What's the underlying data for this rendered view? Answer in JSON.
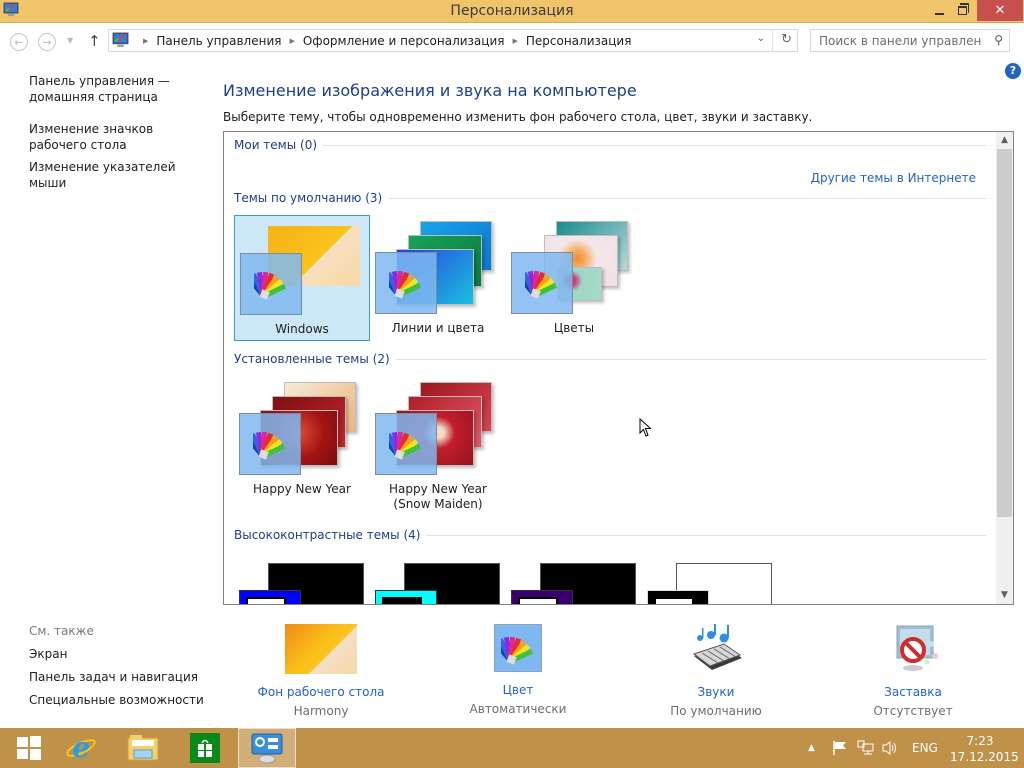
{
  "window": {
    "title": "Персонализация",
    "controls": {
      "minimize": "–",
      "maximize": "□",
      "close": "✕"
    }
  },
  "navbar": {
    "back_icon": "←",
    "forward_icon": "→",
    "recent_icon": "▼",
    "up_icon": "↑",
    "breadcrumbs": [
      "Панель управления",
      "Оформление и персонализация",
      "Персонализация"
    ],
    "breadcrumb_separator": "▶",
    "dropdown_icon": "⌄",
    "refresh_icon": "↻",
    "search": {
      "placeholder": "Поиск в панели управления",
      "value": "",
      "icon": "⚲"
    }
  },
  "help_icon": "?",
  "sidebar": {
    "links": [
      "Панель управления — домашняя страница",
      "Изменение значков рабочего стола",
      "Изменение указателей мыши"
    ],
    "see_also_title": "См. также",
    "see_also": [
      "Экран",
      "Панель задач и навигация",
      "Специальные возможности"
    ]
  },
  "main": {
    "title": "Изменение изображения и звука на компьютере",
    "description": "Выберите тему, чтобы одновременно изменить фон рабочего стола, цвет, звуки и заставку.",
    "online_link": "Другие темы в Интернете",
    "groups": [
      {
        "label": "Мои темы (0)"
      },
      {
        "label": "Темы по умолчанию (3)"
      },
      {
        "label": "Установленные темы (2)"
      },
      {
        "label": "Высококонтрастные темы (4)"
      }
    ],
    "themes": {
      "default": [
        {
          "label": "Windows",
          "selected": true
        },
        {
          "label": "Линии и цвета",
          "selected": false
        },
        {
          "label": "Цветы",
          "selected": false
        }
      ],
      "installed": [
        {
          "label": "Happy New Year"
        },
        {
          "label": "Happy New Year\n(Snow Maiden)"
        }
      ],
      "high_contrast": [
        {
          "big": "#000000",
          "small": "#0000ff",
          "inner": "#ffffff"
        },
        {
          "big": "#000000",
          "small": "#00ffff",
          "inner": "#000000"
        },
        {
          "big": "#000000",
          "small": "#37006e",
          "inner": "#ffffff"
        },
        {
          "big": "#ffffff",
          "small": "#000000",
          "inner": "#ffffff"
        }
      ]
    },
    "scroll": {
      "position": 0,
      "visible_fraction": 0.84
    }
  },
  "options": [
    {
      "label": "Фон рабочего стола",
      "value": "Harmony"
    },
    {
      "label": "Цвет",
      "value": "Автоматически"
    },
    {
      "label": "Звуки",
      "value": "По умолчанию"
    },
    {
      "label": "Заставка",
      "value": "Отсутствует"
    }
  ],
  "taskbar": {
    "tray": {
      "language": "ENG",
      "time": "7:23",
      "date": "17.12.2015"
    }
  },
  "colors": {
    "titlebar": "#f0c46b",
    "taskbar": "#c09148",
    "heading": "#1d3e8c",
    "link": "#2363c8",
    "selection": "#cce8f6",
    "close": "#c7504d"
  }
}
